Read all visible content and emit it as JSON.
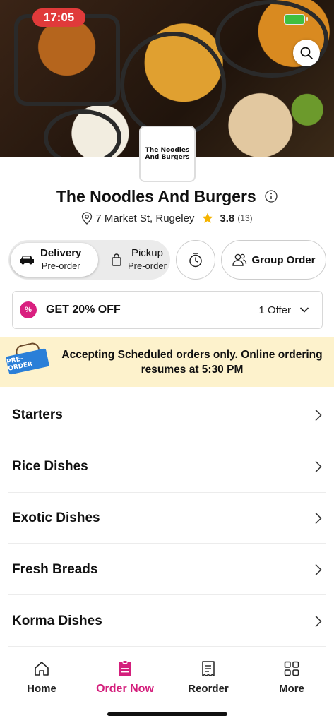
{
  "status_bar": {
    "time": "17:05"
  },
  "restaurant": {
    "logo_line1": "The Noodles",
    "logo_line2": "And Burgers",
    "name": "The Noodles And Burgers",
    "address": "7 Market St, Rugeley",
    "rating": "3.8",
    "rating_count": "(13)"
  },
  "order_mode": {
    "delivery_label": "Delivery",
    "delivery_sub": "Pre-order",
    "pickup_label": "Pickup",
    "pickup_sub": "Pre-order",
    "selected": "Delivery"
  },
  "group_order_label": "Group Order",
  "offer": {
    "badge": "%",
    "text": "GET 20% OFF",
    "count": "1 Offer"
  },
  "banner": {
    "sign_text": "PRE-ORDER",
    "message": "Accepting Scheduled orders only. Online ordering resumes at 5:30 PM"
  },
  "menu_categories": [
    "Starters",
    "Rice Dishes",
    "Exotic Dishes",
    "Fresh Breads",
    "Korma Dishes"
  ],
  "tabs": [
    {
      "label": "Home",
      "icon": "home-icon"
    },
    {
      "label": "Order Now",
      "icon": "order-icon"
    },
    {
      "label": "Reorder",
      "icon": "receipt-icon"
    },
    {
      "label": "More",
      "icon": "grid-icon"
    }
  ],
  "colors": {
    "accent": "#d41f7c",
    "banner_bg": "#fdf2cc",
    "time_pill": "#e03a3a",
    "star": "#f5b400",
    "preorder_sign": "#2a7fd8"
  }
}
